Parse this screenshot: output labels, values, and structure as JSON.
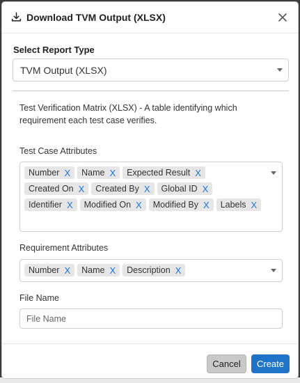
{
  "dialog": {
    "title": "Download TVM Output (XLSX)",
    "icon": "download-icon",
    "close_icon": "close-icon"
  },
  "report_type": {
    "label": "Select Report Type",
    "selected": "TVM Output (XLSX)"
  },
  "description": "Test Verification Matrix (XLSX)  -  A table identifying which requirement each test case verifies.",
  "test_case_attributes": {
    "label": "Test Case Attributes",
    "tags": [
      "Number",
      "Name",
      "Expected Result",
      "Created On",
      "Created By",
      "Global ID",
      "Identifier",
      "Modified On",
      "Modified By",
      "Labels"
    ],
    "remove_symbol": "X"
  },
  "requirement_attributes": {
    "label": "Requirement Attributes",
    "tags": [
      "Number",
      "Name",
      "Description"
    ],
    "remove_symbol": "X"
  },
  "file_name": {
    "label": "File Name",
    "value": "",
    "placeholder": "File Name"
  },
  "footer": {
    "cancel_label": "Cancel",
    "create_label": "Create"
  },
  "colors": {
    "primary": "#1f74c9",
    "remove_x": "#1a73e8",
    "tag_bg": "#e6e6e6"
  }
}
